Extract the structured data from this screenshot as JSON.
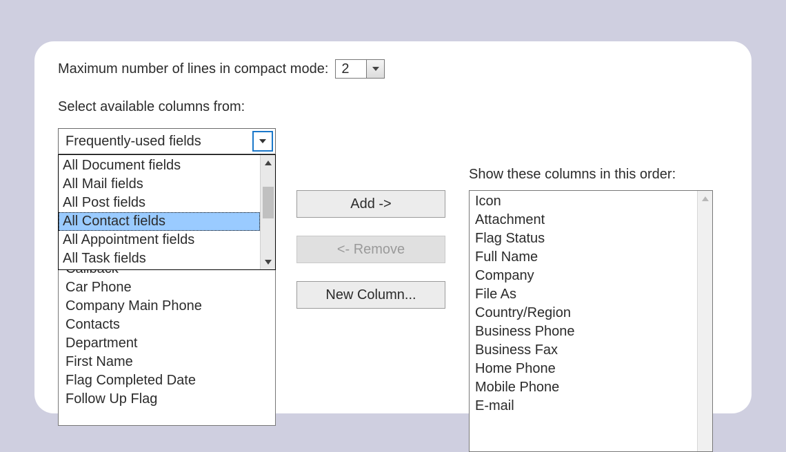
{
  "compact": {
    "label": "Maximum number of lines in compact mode:",
    "value": "2"
  },
  "select_from": {
    "label": "Select available columns from:",
    "combo_value": "Frequently-used fields",
    "dropdown": [
      "All Document fields",
      "All Mail fields",
      "All Post fields",
      "All Contact fields",
      "All Appointment fields",
      "All Task fields"
    ],
    "dropdown_selected_index": 3
  },
  "available_tail": [
    "Callback",
    "Car Phone",
    "Company Main Phone",
    "Contacts",
    "Department",
    "First Name",
    "Flag Completed Date",
    "Follow Up Flag"
  ],
  "buttons": {
    "add": "Add ->",
    "remove": "<- Remove",
    "new_column": "New Column..."
  },
  "show_order": {
    "label": "Show these columns in this order:",
    "items": [
      "Icon",
      "Attachment",
      "Flag Status",
      "Full Name",
      "Company",
      "File As",
      "Country/Region",
      "Business Phone",
      "Business Fax",
      "Home Phone",
      "Mobile Phone",
      "E-mail"
    ]
  }
}
